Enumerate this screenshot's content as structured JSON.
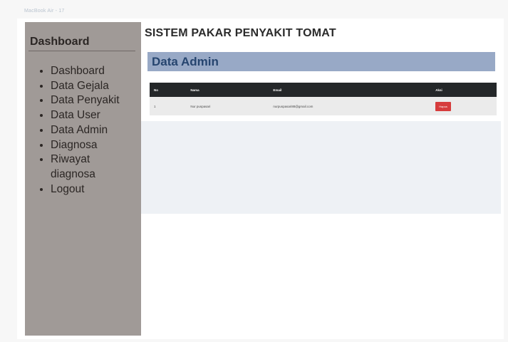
{
  "window": {
    "device_label": "MacBook Air - 17"
  },
  "sidebar": {
    "title": "Dashboard",
    "items": [
      {
        "label": "Dashboard"
      },
      {
        "label": "Data Gejala"
      },
      {
        "label": "Data Penyakit"
      },
      {
        "label": "Data User"
      },
      {
        "label": "Data Admin"
      },
      {
        "label": "Diagnosa"
      },
      {
        "label": " Riwayat\ndiagnosa"
      },
      {
        "label": "Logout"
      }
    ]
  },
  "main": {
    "title": "SISTEM PAKAR PENYAKIT TOMAT",
    "panel_title": "Data Admin",
    "table": {
      "headers": [
        "No",
        "Nama",
        "Email",
        "Aksi"
      ],
      "rows": [
        {
          "no": "1",
          "nama": "Nur puspasari",
          "email": "nurpuspasari88@gmail.com",
          "action_label": "Hapus"
        }
      ]
    }
  },
  "colors": {
    "sidebar_bg": "#a09a97",
    "panel_header_bg": "#98a9c6",
    "table_header_bg": "#242729",
    "delete_button": "#d63c3c"
  }
}
